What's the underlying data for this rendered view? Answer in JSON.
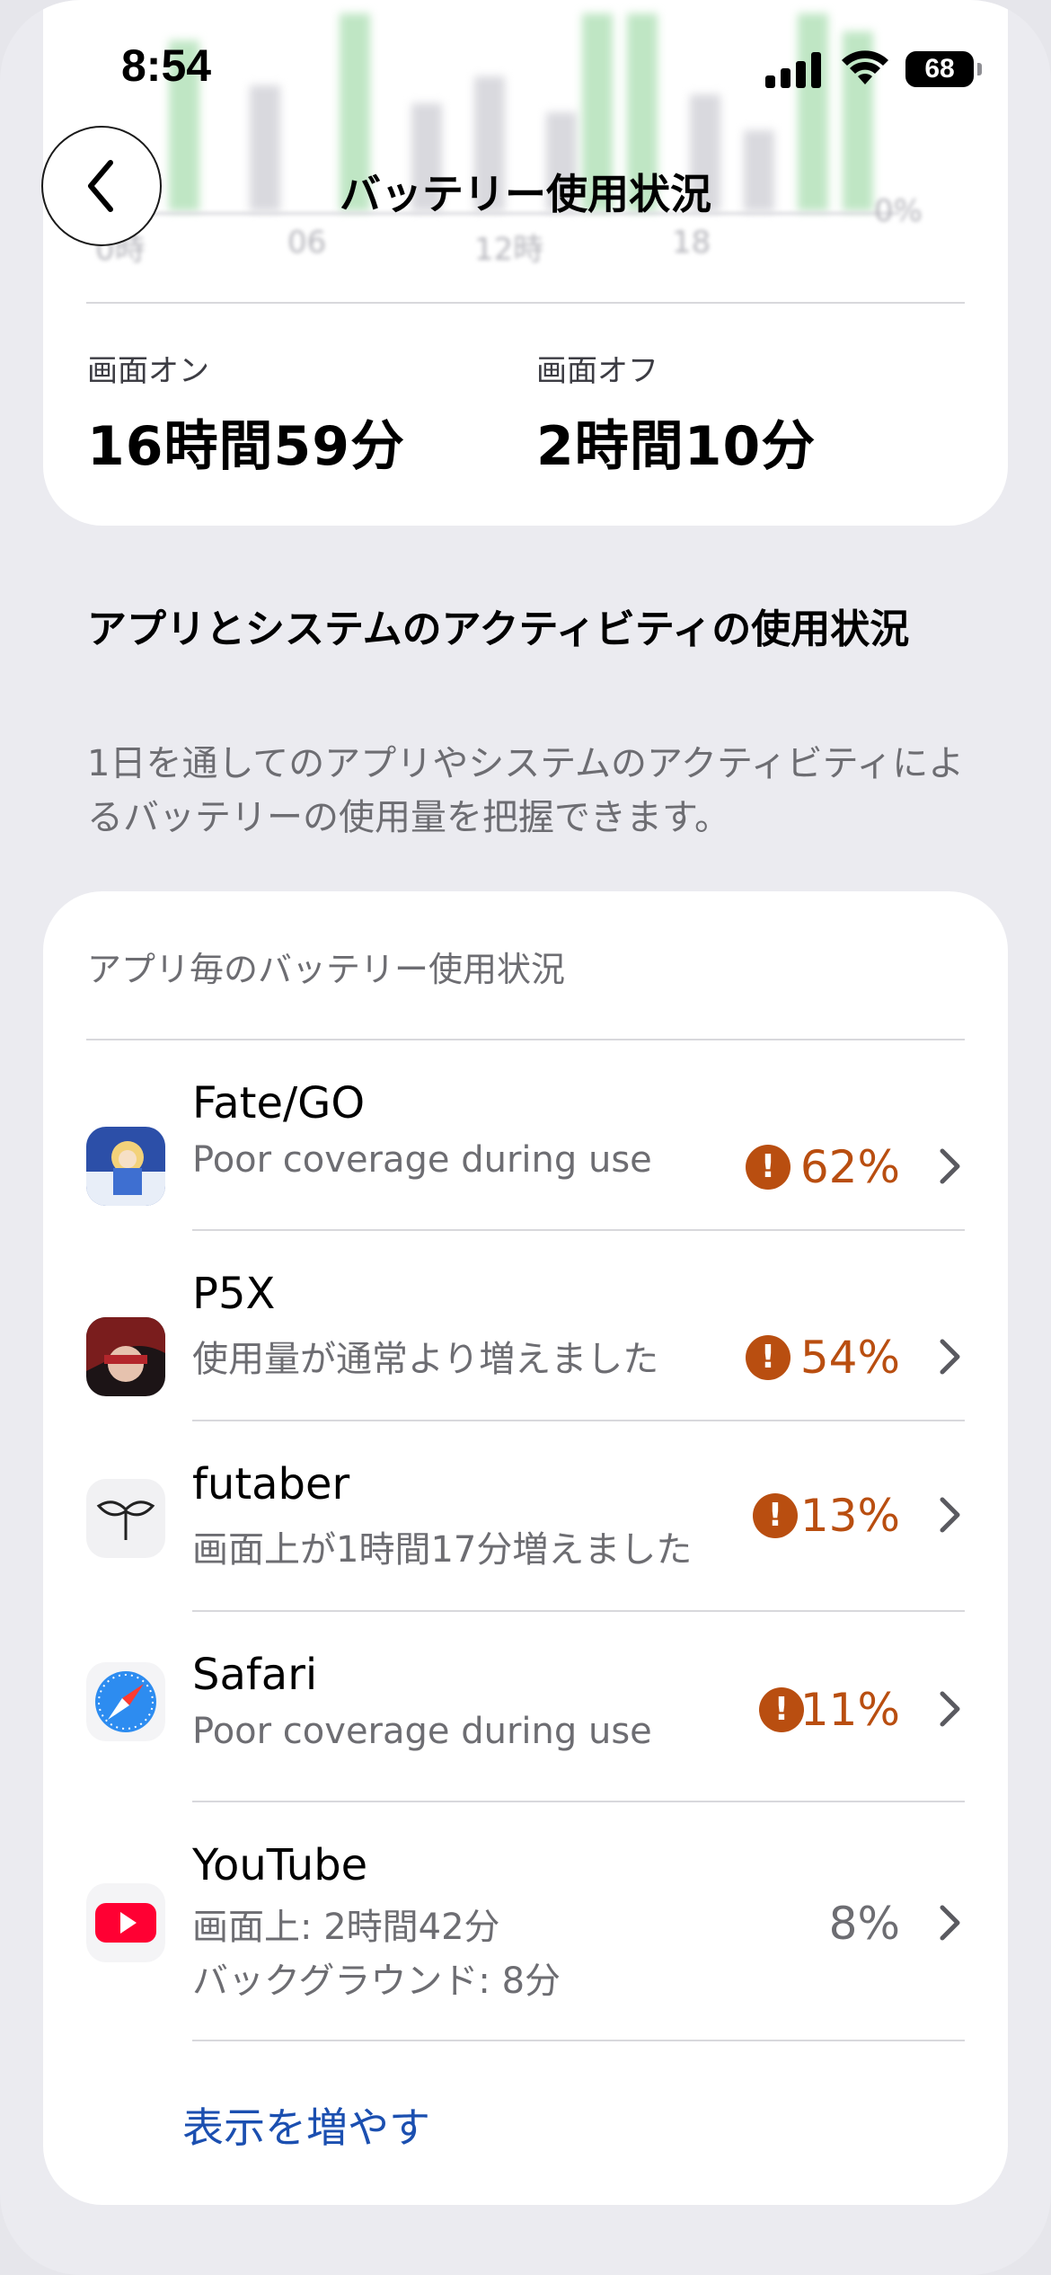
{
  "status_bar": {
    "time": "8:54",
    "battery": "68"
  },
  "chart": {
    "ticks": [
      "0時",
      "06",
      "12時",
      "18",
      "0%"
    ]
  },
  "nav": {
    "title": "バッテリー使用状況"
  },
  "screen_time": {
    "on_label": "画面オン",
    "on_value": "16時間59分",
    "off_label": "画面オフ",
    "off_value": "2時間10分"
  },
  "activity_section": {
    "title": "アプリとシステムのアクティビティの使用状況",
    "description": "1日を通してのアプリやシステムのアクティビティによるバッテリーの使用量を把握できます。"
  },
  "app_list": {
    "header": "アプリ毎のバッテリー使用状況",
    "apps": [
      {
        "name": "Fate/GO",
        "sub": "Poor coverage during use",
        "percent": "62%",
        "warning": true
      },
      {
        "name": "P5X",
        "sub": "使用量が通常より増えました",
        "percent": "54%",
        "warning": true
      },
      {
        "name": "futaber",
        "sub": "画面上が1時間17分増えました",
        "percent": "13%",
        "warning": true
      },
      {
        "name": "Safari",
        "sub": "Poor coverage during use",
        "percent": "11%",
        "warning": true
      },
      {
        "name": "YouTube",
        "sub": "画面上: 2時間42分",
        "sub2": "バックグラウンド: 8分",
        "percent": "8%",
        "warning": false
      }
    ],
    "show_more": "表示を増やす"
  },
  "colors": {
    "warning": "#b94e10",
    "link": "#1b4fb0",
    "background": "#ebebf0"
  }
}
